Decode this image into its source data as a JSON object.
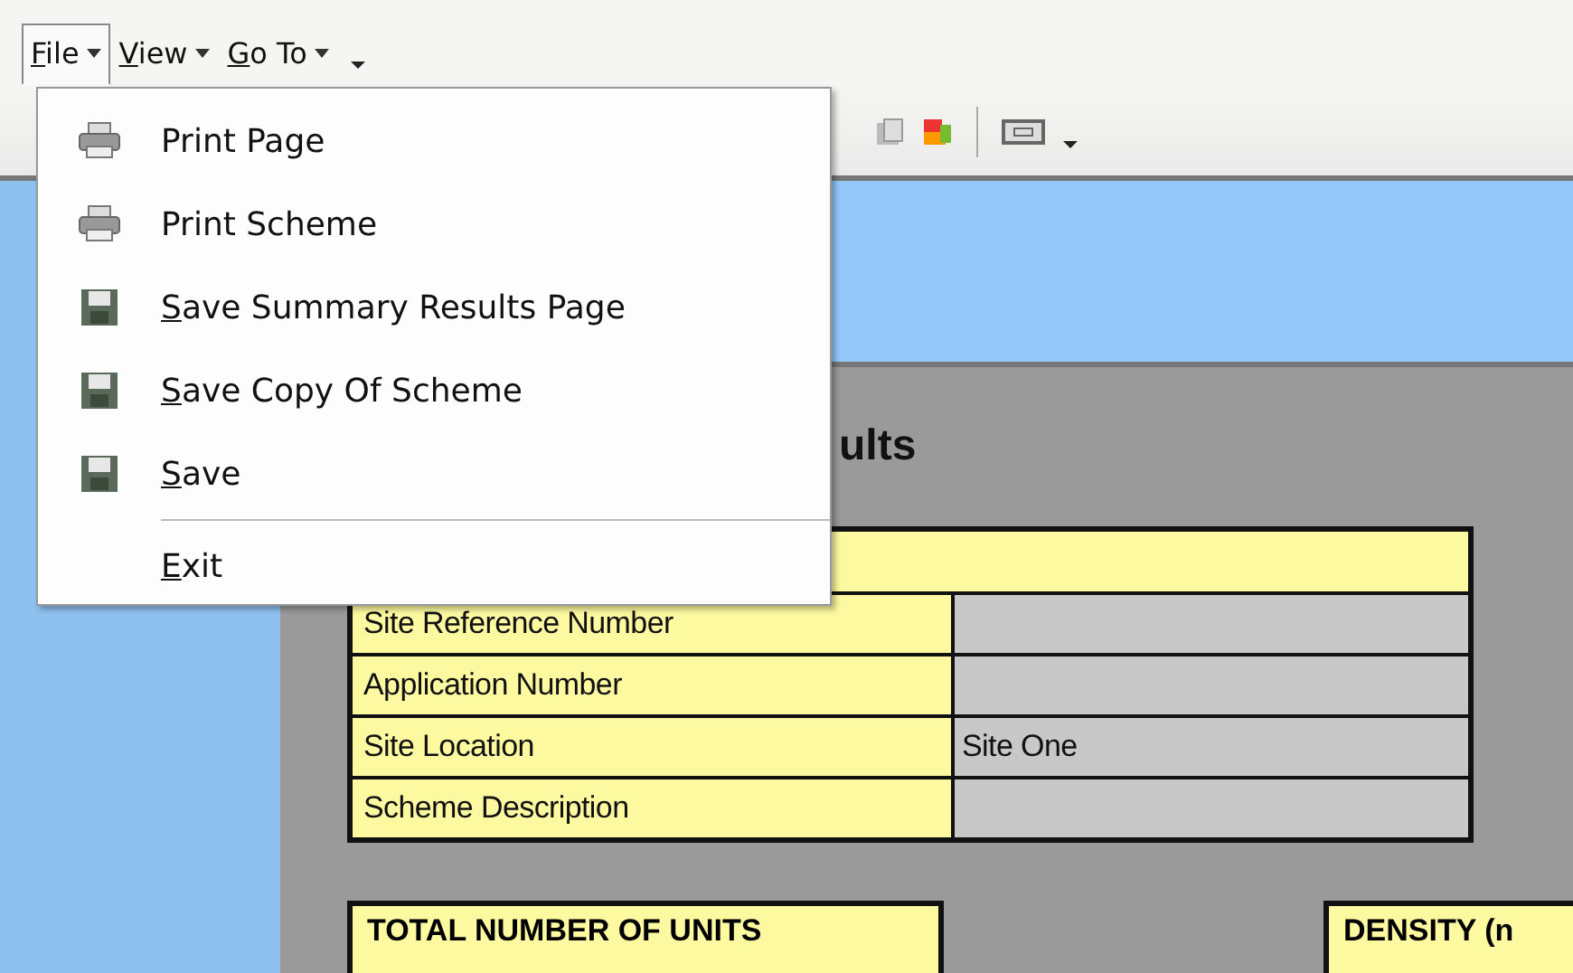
{
  "menu_bar": [
    {
      "label": "File",
      "underlined_key": true,
      "selected": true
    },
    {
      "label": "View",
      "underlined_key": true,
      "selected": false
    },
    {
      "label": "Go To",
      "underlined_key": true,
      "selected": false
    }
  ],
  "file_menu": [
    {
      "label": "Print Page",
      "kind": "print",
      "underlined_key": false
    },
    {
      "label": "Print Scheme",
      "kind": "print",
      "underlined_key": false
    },
    {
      "label": "Save Summary Results Page",
      "kind": "save",
      "underlined_key": true
    },
    {
      "label": "Save Copy Of Scheme",
      "kind": "save",
      "underlined_key": true
    },
    {
      "label": "Save",
      "kind": "save",
      "underlined_key": true
    },
    {
      "label": "Exit",
      "kind": "plain",
      "underlined_key": true,
      "separator_before": true
    }
  ],
  "page": {
    "title": "ults",
    "details": [
      {
        "label": "Site Reference Number"
      },
      {
        "label": "Application Number"
      },
      {
        "label": "Site Location",
        "value": "Site One"
      },
      {
        "label": "Scheme Description"
      }
    ],
    "totals": [
      {
        "label": "TOTAL NUMBER OF UNITS"
      },
      {
        "label": "DENSITY  (n"
      }
    ]
  }
}
